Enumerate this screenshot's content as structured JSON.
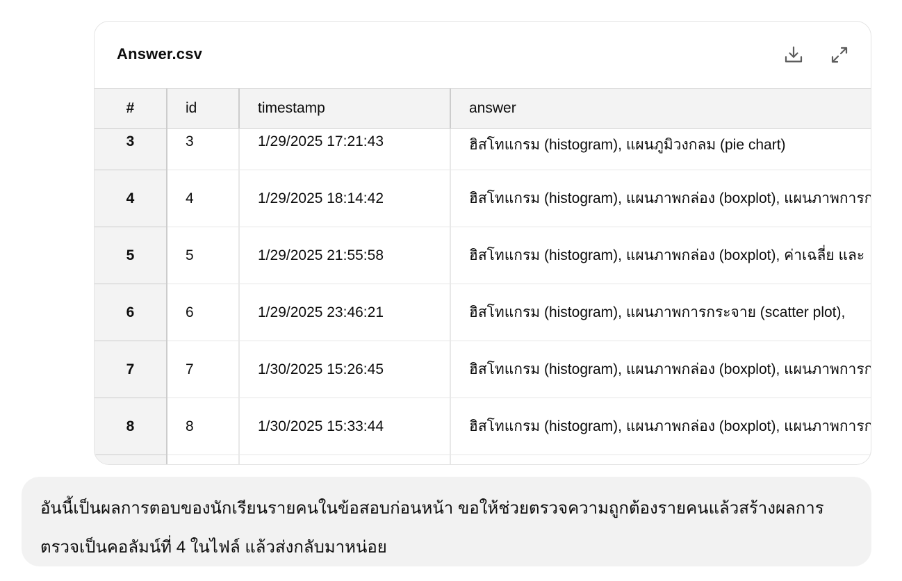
{
  "file": {
    "title": "Answer.csv",
    "download_icon": "download-icon",
    "expand_icon": "expand-icon"
  },
  "table": {
    "columns": [
      "#",
      "id",
      "timestamp",
      "answer"
    ],
    "rows": [
      {
        "num": "3",
        "id": "3",
        "timestamp": "1/29/2025 17:21:43",
        "answer": "ฮิสโทแกรม (histogram), แผนภูมิวงกลม (pie chart)"
      },
      {
        "num": "4",
        "id": "4",
        "timestamp": "1/29/2025 18:14:42",
        "answer": "ฮิสโทแกรม (histogram), แผนภาพกล่อง (boxplot), แผนภาพการกระจาย"
      },
      {
        "num": "5",
        "id": "5",
        "timestamp": "1/29/2025 21:55:58",
        "answer": "ฮิสโทแกรม (histogram), แผนภาพกล่อง (boxplot), ค่าเฉลี่ย และ"
      },
      {
        "num": "6",
        "id": "6",
        "timestamp": "1/29/2025 23:46:21",
        "answer": "ฮิสโทแกรม (histogram), แผนภาพการกระจาย (scatter plot),"
      },
      {
        "num": "7",
        "id": "7",
        "timestamp": "1/30/2025 15:26:45",
        "answer": "ฮิสโทแกรม (histogram), แผนภาพกล่อง (boxplot), แผนภาพการกระจาย"
      },
      {
        "num": "8",
        "id": "8",
        "timestamp": "1/30/2025 15:33:44",
        "answer": "ฮิสโทแกรม (histogram), แผนภาพกล่อง (boxplot), แผนภาพการกระจาย"
      }
    ]
  },
  "message": {
    "text": "อันนี้เป็นผลการตอบของนักเรียนรายคนในข้อสอบก่อนหน้า ขอให้ช่วยตรวจความถูกต้องรายคนแล้วสร้างผลการตรวจเป็นคอลัมน์ที่ 4 ในไฟล์ แล้วส่งกลับมาหน่อย"
  }
}
